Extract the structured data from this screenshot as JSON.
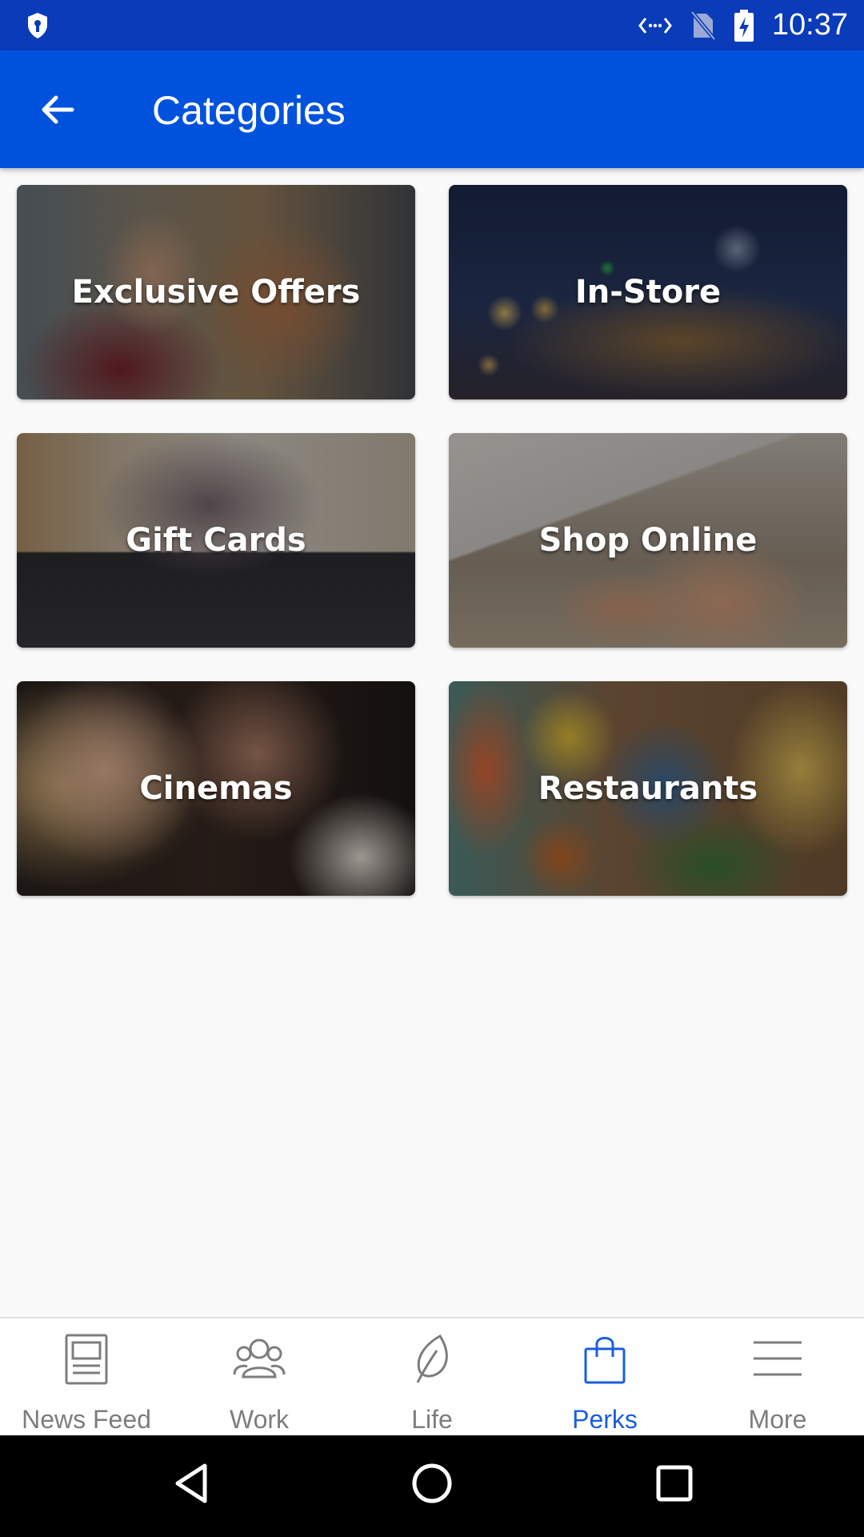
{
  "status_bar": {
    "time": "10:37",
    "icons": [
      "shield-icon",
      "data-arrows-icon",
      "no-sim-icon",
      "battery-charging-icon"
    ],
    "background": "#0a3bb8"
  },
  "app_bar": {
    "title": "Categories",
    "back_icon": "arrow-back-icon",
    "background": "#0052dd"
  },
  "categories": [
    {
      "label": "Exclusive Offers"
    },
    {
      "label": "In-Store"
    },
    {
      "label": "Gift Cards"
    },
    {
      "label": "Shop Online"
    },
    {
      "label": "Cinemas"
    },
    {
      "label": "Restaurants"
    }
  ],
  "bottom_nav": {
    "items": [
      {
        "label": "News Feed",
        "icon": "news-feed-icon",
        "active": false
      },
      {
        "label": "Work",
        "icon": "people-icon",
        "active": false
      },
      {
        "label": "Life",
        "icon": "leaf-icon",
        "active": false
      },
      {
        "label": "Perks",
        "icon": "shopping-bag-icon",
        "active": true
      },
      {
        "label": "More",
        "icon": "menu-icon",
        "active": false
      }
    ],
    "active_color": "#1a5ee0",
    "inactive_color": "#7d7d7d"
  },
  "system_nav": {
    "buttons": [
      "back-triangle-icon",
      "home-circle-icon",
      "recents-square-icon"
    ]
  }
}
